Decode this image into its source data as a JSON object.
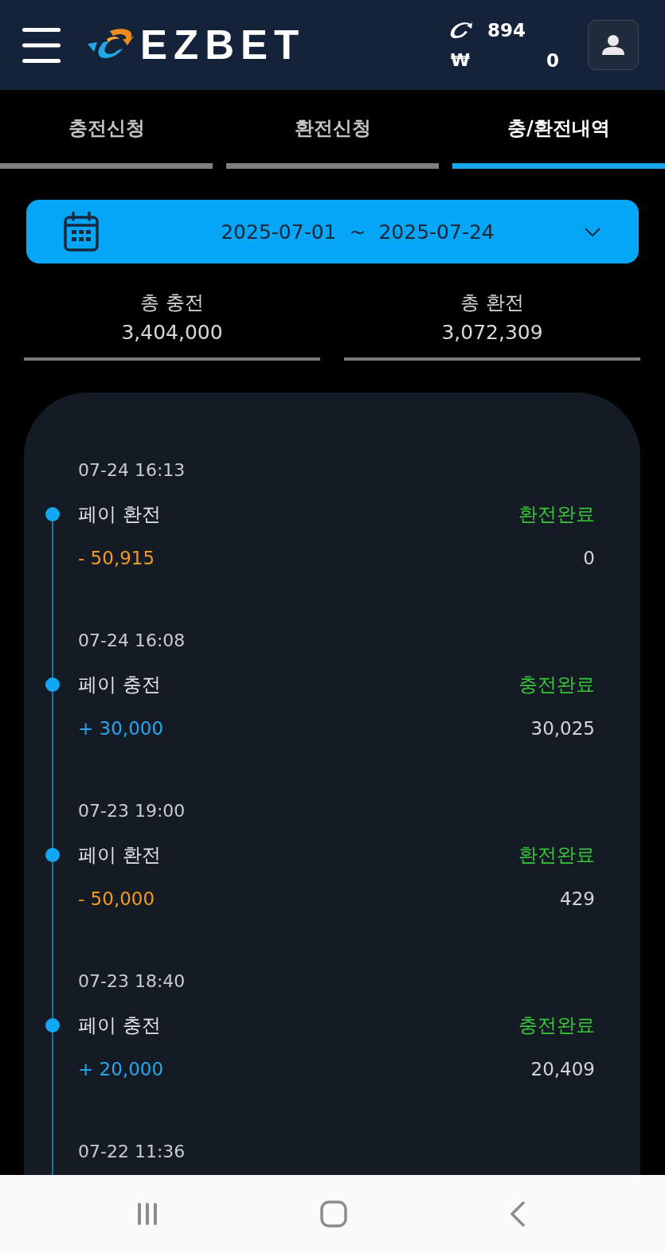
{
  "header": {
    "logo": "EZBET",
    "points": "894",
    "currency_symbol": "₩",
    "balance": "0"
  },
  "tabs": [
    {
      "label": "충전신청",
      "selected": false
    },
    {
      "label": "환전신청",
      "selected": false
    },
    {
      "label": "충/환전내역",
      "selected": true
    }
  ],
  "date_range": {
    "start": "2025-07-01",
    "separator": "~",
    "end": "2025-07-24"
  },
  "totals": [
    {
      "label": "총 충전",
      "value": "3,404,000"
    },
    {
      "label": "총 환전",
      "value": "3,072,309"
    }
  ],
  "transactions": [
    {
      "time": "07-24 16:13",
      "title": "페이 환전",
      "status": "환전완료",
      "kind": "withdrawal",
      "amount": "- 50,915",
      "balance": "0"
    },
    {
      "time": "07-24 16:08",
      "title": "페이 충전",
      "status": "충전완료",
      "kind": "deposit",
      "amount": "+ 30,000",
      "balance": "30,025"
    },
    {
      "time": "07-23 19:00",
      "title": "페이 환전",
      "status": "환전완료",
      "kind": "withdrawal",
      "amount": "- 50,000",
      "balance": "429"
    },
    {
      "time": "07-23 18:40",
      "title": "페이 충전",
      "status": "충전완료",
      "kind": "deposit",
      "amount": "+ 20,000",
      "balance": "20,409"
    },
    {
      "time": "07-22 11:36"
    }
  ]
}
